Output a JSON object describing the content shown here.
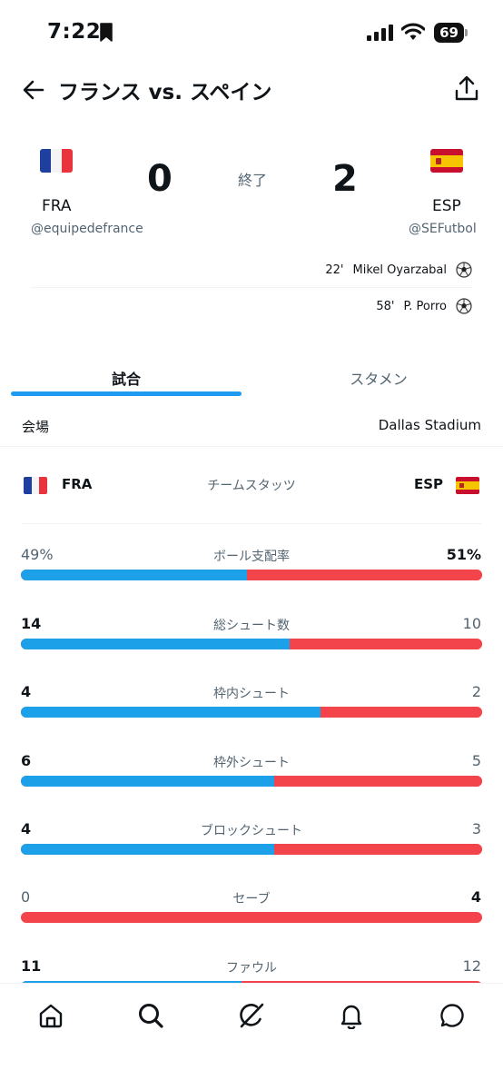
{
  "status_bar": {
    "time": "7:22",
    "battery": "69",
    "icons": [
      "bookmark-icon",
      "signal-icon",
      "wifi-icon",
      "battery-icon"
    ]
  },
  "header": {
    "title": "フランス vs. スペイン",
    "icons": [
      "back-arrow-icon",
      "share-icon"
    ]
  },
  "match": {
    "home": {
      "code": "FRA",
      "handle": "@equipedefrance",
      "score": "0",
      "flag_icon": "france-flag-icon"
    },
    "away": {
      "code": "ESP",
      "handle": "@SEFutbol",
      "score": "2",
      "flag_icon": "spain-flag-icon"
    },
    "status": "終了",
    "goals": [
      {
        "minute": "22'",
        "player": "Mikel Oyarzabal",
        "icon": "soccer-ball-icon"
      },
      {
        "minute": "58'",
        "player": "P. Porro",
        "icon": "soccer-ball-icon"
      }
    ]
  },
  "tabs": [
    {
      "label": "試合",
      "active": true
    },
    {
      "label": "スタメン",
      "active": false
    }
  ],
  "venue": {
    "label": "会場",
    "value": "Dallas Stadium"
  },
  "team_stats": {
    "title": "チームスタッツ",
    "home_code": "FRA",
    "away_code": "ESP",
    "rows": [
      {
        "label": "ボール支配率",
        "home": "49%",
        "away": "51%",
        "home_fraction": 0.49
      },
      {
        "label": "総シュート数",
        "home": "14",
        "away": "10",
        "home_fraction": 0.583
      },
      {
        "label": "枠内シュート",
        "home": "4",
        "away": "2",
        "home_fraction": 0.65
      },
      {
        "label": "枠外シュート",
        "home": "6",
        "away": "5",
        "home_fraction": 0.55
      },
      {
        "label": "ブロックシュート",
        "home": "4",
        "away": "3",
        "home_fraction": 0.55
      },
      {
        "label": "セーブ",
        "home": "0",
        "away": "4",
        "home_fraction": 0.0
      },
      {
        "label": "ファウル",
        "home": "11",
        "away": "12",
        "home_fraction": 0.478
      }
    ]
  },
  "colors": {
    "home_bar": "#1ca0e8",
    "away_bar": "#f4444b",
    "tab_indicator": "#1d9bf0"
  },
  "bottom_nav": {
    "items": [
      "home-icon",
      "search-icon",
      "grok-icon",
      "notifications-icon",
      "messages-icon"
    ]
  }
}
